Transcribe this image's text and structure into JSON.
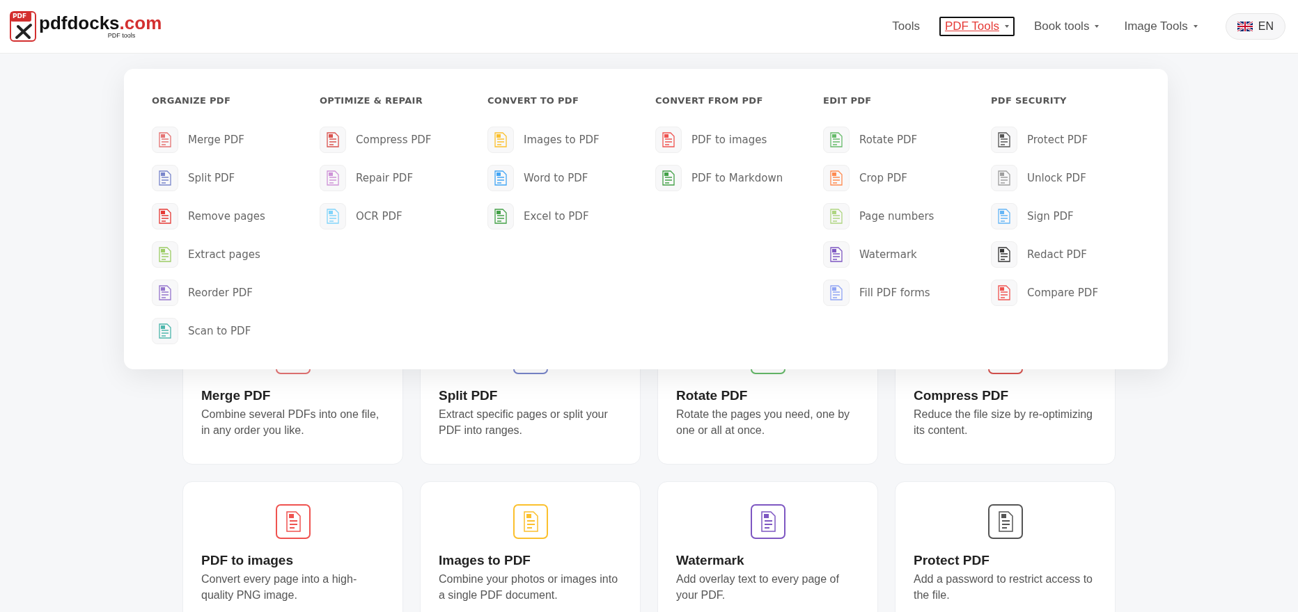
{
  "header": {
    "logo": {
      "badge": "PDF",
      "name": "pdfdocks",
      "domain": ".com",
      "tagline": "PDF tools"
    },
    "nav": [
      {
        "label": "Tools",
        "kind": "link",
        "selected": false
      },
      {
        "label": "PDF Tools",
        "kind": "dropdown",
        "selected": true
      },
      {
        "label": "Book tools",
        "kind": "dropdown",
        "selected": false
      },
      {
        "label": "Image Tools",
        "kind": "dropdown",
        "selected": false
      }
    ],
    "language": {
      "label": "EN"
    }
  },
  "menu": {
    "columns": [
      {
        "heading": "ORGANIZE PDF",
        "items": [
          {
            "label": "Merge PDF",
            "color": "#e57373"
          },
          {
            "label": "Split PDF",
            "color": "#7986cb"
          },
          {
            "label": "Remove pages",
            "color": "#e53935"
          },
          {
            "label": "Extract pages",
            "color": "#9ccc65"
          },
          {
            "label": "Reorder PDF",
            "color": "#9575cd"
          },
          {
            "label": "Scan to PDF",
            "color": "#4db6ac"
          }
        ]
      },
      {
        "heading": "OPTIMIZE & REPAIR",
        "items": [
          {
            "label": "Compress PDF",
            "color": "#d9534f"
          },
          {
            "label": "Repair PDF",
            "color": "#ce93d8"
          },
          {
            "label": "OCR PDF",
            "color": "#81d4fa"
          }
        ]
      },
      {
        "heading": "CONVERT TO PDF",
        "items": [
          {
            "label": "Images to PDF",
            "color": "#fbc02d"
          },
          {
            "label": "Word to PDF",
            "color": "#42a5f5"
          },
          {
            "label": "Excel to PDF",
            "color": "#43a047"
          }
        ]
      },
      {
        "heading": "CONVERT FROM PDF",
        "items": [
          {
            "label": "PDF to images",
            "color": "#ef5350"
          },
          {
            "label": "PDF to Markdown",
            "color": "#43a047"
          }
        ]
      },
      {
        "heading": "EDIT PDF",
        "items": [
          {
            "label": "Rotate PDF",
            "color": "#66bb6a"
          },
          {
            "label": "Crop PDF",
            "color": "#ff8a50"
          },
          {
            "label": "Page numbers",
            "color": "#aed581"
          },
          {
            "label": "Watermark",
            "color": "#7e57c2"
          },
          {
            "label": "Fill PDF forms",
            "color": "#90a4f4"
          }
        ]
      },
      {
        "heading": "PDF SECURITY",
        "items": [
          {
            "label": "Protect PDF",
            "color": "#555555"
          },
          {
            "label": "Unlock PDF",
            "color": "#9e9e9e"
          },
          {
            "label": "Sign PDF",
            "color": "#64b5f6"
          },
          {
            "label": "Redact PDF",
            "color": "#333333"
          },
          {
            "label": "Compare PDF",
            "color": "#ef5350"
          }
        ]
      }
    ]
  },
  "cards": [
    {
      "title": "Merge PDF",
      "description": "Combine several PDFs into one file, in any order you like.",
      "color": "#e57373"
    },
    {
      "title": "Split PDF",
      "description": "Extract specific pages or split your PDF into ranges.",
      "color": "#7986cb"
    },
    {
      "title": "Rotate PDF",
      "description": "Rotate the pages you need, one by one or all at once.",
      "color": "#66bb6a"
    },
    {
      "title": "Compress PDF",
      "description": "Reduce the file size by re-optimizing its content.",
      "color": "#d9534f"
    },
    {
      "title": "PDF to images",
      "description": "Convert every page into a high-quality PNG image.",
      "color": "#ef5350"
    },
    {
      "title": "Images to PDF",
      "description": "Combine your photos or images into a single PDF document.",
      "color": "#fbc02d"
    },
    {
      "title": "Watermark",
      "description": "Add overlay text to every page of your PDF.",
      "color": "#7e57c2"
    },
    {
      "title": "Protect PDF",
      "description": "Add a password to restrict access to the file.",
      "color": "#555555"
    }
  ]
}
